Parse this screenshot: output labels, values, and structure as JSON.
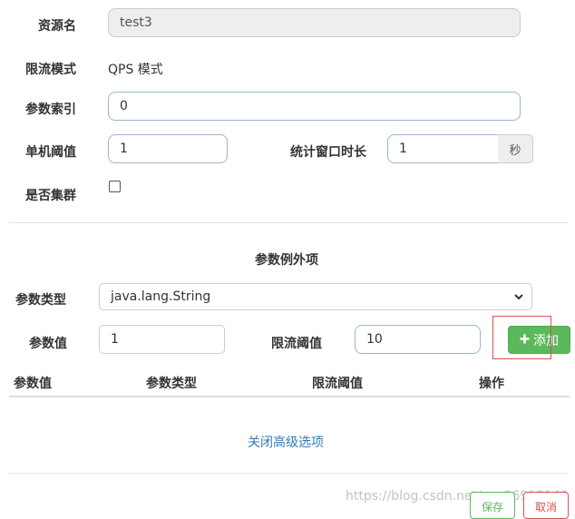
{
  "form": {
    "resource_name": {
      "label": "资源名",
      "value": "test3"
    },
    "limit_mode": {
      "label": "限流模式",
      "value": "QPS 模式"
    },
    "param_index": {
      "label": "参数索引",
      "value": "0"
    },
    "single_threshold": {
      "label": "单机阈值",
      "value": "1"
    },
    "window": {
      "label": "统计窗口时长",
      "value": "1",
      "unit": "秒"
    },
    "cluster": {
      "label": "是否集群",
      "checked": false
    }
  },
  "exceptions": {
    "title": "参数例外项",
    "param_type": {
      "label": "参数类型",
      "selected": "java.lang.String"
    },
    "param_value": {
      "label": "参数值",
      "value": "1"
    },
    "threshold": {
      "label": "限流阈值",
      "value": "10"
    },
    "add_button": "添加",
    "table_headers": [
      "参数值",
      "参数类型",
      "限流阈值",
      "操作"
    ]
  },
  "advanced_link": "关闭高级选项",
  "footer": {
    "save": "保存",
    "cancel": "取消"
  },
  "watermark": "https://blog.csdn.net/qq_36918149",
  "colors": {
    "accent": "#337ab7",
    "success": "#5cb85c",
    "danger": "#d9534f"
  }
}
